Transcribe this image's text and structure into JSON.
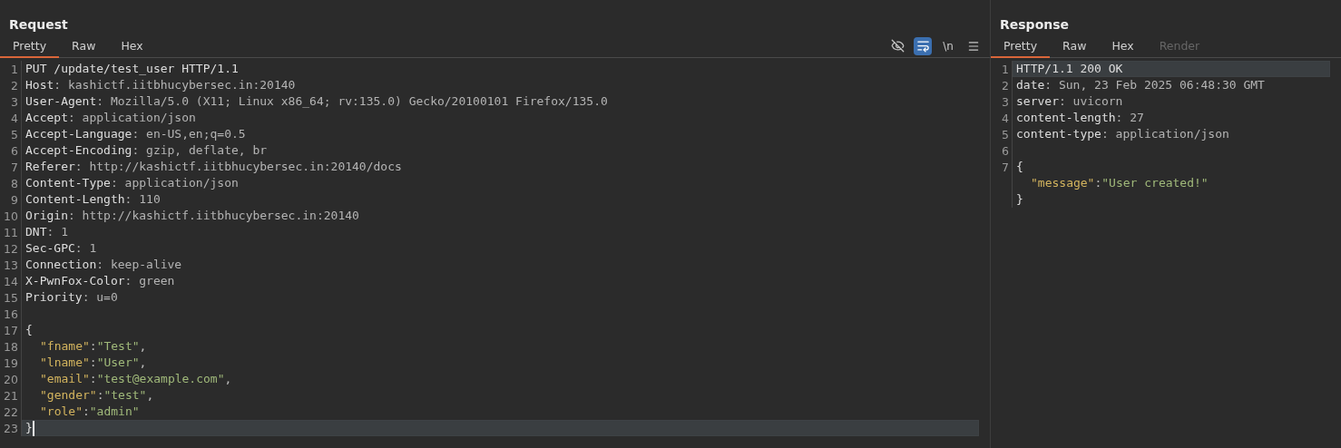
{
  "panes": [
    {
      "title": "Request",
      "tabs": [
        {
          "label": "Pretty",
          "selected": true,
          "disabled": false
        },
        {
          "label": "Raw",
          "selected": false,
          "disabled": false
        },
        {
          "label": "Hex",
          "selected": false,
          "disabled": false
        }
      ],
      "toolbar": [
        {
          "kind": "hide",
          "selected": false
        },
        {
          "kind": "wrap",
          "selected": true
        },
        {
          "kind": "newline",
          "label": "\\n",
          "selected": false
        },
        {
          "kind": "menu",
          "selected": false
        }
      ],
      "lines": [
        {
          "number": "1",
          "current": false,
          "cursor": false,
          "indented": false,
          "segments": [
            {
              "kind": "plain",
              "text": "PUT /update/test_user HTTP/1.1"
            }
          ]
        },
        {
          "number": "2",
          "current": false,
          "cursor": false,
          "indented": false,
          "segments": [
            {
              "kind": "name",
              "text": "Host"
            },
            {
              "kind": "value",
              "text": ": kashictf.iitbhucybersec.in:20140"
            }
          ]
        },
        {
          "number": "3",
          "current": false,
          "cursor": false,
          "indented": false,
          "segments": [
            {
              "kind": "name",
              "text": "User-Agent"
            },
            {
              "kind": "value",
              "text": ": Mozilla/5.0 (X11; Linux x86_64; rv:135.0) Gecko/20100101 Firefox/135.0"
            }
          ]
        },
        {
          "number": "4",
          "current": false,
          "cursor": false,
          "indented": false,
          "segments": [
            {
              "kind": "name",
              "text": "Accept"
            },
            {
              "kind": "value",
              "text": ": application/json"
            }
          ]
        },
        {
          "number": "5",
          "current": false,
          "cursor": false,
          "indented": false,
          "segments": [
            {
              "kind": "name",
              "text": "Accept-Language"
            },
            {
              "kind": "value",
              "text": ": en-US,en;q=0.5"
            }
          ]
        },
        {
          "number": "6",
          "current": false,
          "cursor": false,
          "indented": false,
          "segments": [
            {
              "kind": "name",
              "text": "Accept-Encoding"
            },
            {
              "kind": "value",
              "text": ": gzip, deflate, br"
            }
          ]
        },
        {
          "number": "7",
          "current": false,
          "cursor": false,
          "indented": false,
          "segments": [
            {
              "kind": "name",
              "text": "Referer"
            },
            {
              "kind": "value",
              "text": ": http://kashictf.iitbhucybersec.in:20140/docs"
            }
          ]
        },
        {
          "number": "8",
          "current": false,
          "cursor": false,
          "indented": false,
          "segments": [
            {
              "kind": "name",
              "text": "Content-Type"
            },
            {
              "kind": "value",
              "text": ": application/json"
            }
          ]
        },
        {
          "number": "9",
          "current": false,
          "cursor": false,
          "indented": false,
          "segments": [
            {
              "kind": "name",
              "text": "Content-Length"
            },
            {
              "kind": "value",
              "text": ": 110"
            }
          ]
        },
        {
          "number": "10",
          "current": false,
          "cursor": false,
          "indented": false,
          "segments": [
            {
              "kind": "name",
              "text": "Origin"
            },
            {
              "kind": "value",
              "text": ": http://kashictf.iitbhucybersec.in:20140"
            }
          ]
        },
        {
          "number": "11",
          "current": false,
          "cursor": false,
          "indented": false,
          "segments": [
            {
              "kind": "name",
              "text": "DNT"
            },
            {
              "kind": "value",
              "text": ": 1"
            }
          ]
        },
        {
          "number": "12",
          "current": false,
          "cursor": false,
          "indented": false,
          "segments": [
            {
              "kind": "name",
              "text": "Sec-GPC"
            },
            {
              "kind": "value",
              "text": ": 1"
            }
          ]
        },
        {
          "number": "13",
          "current": false,
          "cursor": false,
          "indented": false,
          "segments": [
            {
              "kind": "name",
              "text": "Connection"
            },
            {
              "kind": "value",
              "text": ": keep-alive"
            }
          ]
        },
        {
          "number": "14",
          "current": false,
          "cursor": false,
          "indented": false,
          "segments": [
            {
              "kind": "name",
              "text": "X-PwnFox-Color"
            },
            {
              "kind": "value",
              "text": ": green"
            }
          ]
        },
        {
          "number": "15",
          "current": false,
          "cursor": false,
          "indented": false,
          "segments": [
            {
              "kind": "name",
              "text": "Priority"
            },
            {
              "kind": "value",
              "text": ": u=0"
            }
          ]
        },
        {
          "number": "16",
          "current": false,
          "cursor": false
        },
        {
          "number": "17",
          "current": false,
          "cursor": false,
          "indented": false,
          "segments": [
            {
              "kind": "plain",
              "text": "{"
            }
          ]
        },
        {
          "number": "18",
          "current": false,
          "cursor": false,
          "indented": true,
          "segments": [
            {
              "kind": "jkey",
              "text": "\"fname\""
            },
            {
              "kind": "punct",
              "text": ":"
            },
            {
              "kind": "jstr",
              "text": "\"Test\""
            },
            {
              "kind": "punct",
              "text": ","
            }
          ]
        },
        {
          "number": "19",
          "current": false,
          "cursor": false,
          "indented": true,
          "segments": [
            {
              "kind": "jkey",
              "text": "\"lname\""
            },
            {
              "kind": "punct",
              "text": ":"
            },
            {
              "kind": "jstr",
              "text": "\"User\""
            },
            {
              "kind": "punct",
              "text": ","
            }
          ]
        },
        {
          "number": "20",
          "current": false,
          "cursor": false,
          "indented": true,
          "segments": [
            {
              "kind": "jkey",
              "text": "\"email\""
            },
            {
              "kind": "punct",
              "text": ":"
            },
            {
              "kind": "jstr",
              "text": "\"test@example.com\""
            },
            {
              "kind": "punct",
              "text": ","
            }
          ]
        },
        {
          "number": "21",
          "current": false,
          "cursor": false,
          "indented": true,
          "segments": [
            {
              "kind": "jkey",
              "text": "\"gender\""
            },
            {
              "kind": "punct",
              "text": ":"
            },
            {
              "kind": "jstr",
              "text": "\"test\""
            },
            {
              "kind": "punct",
              "text": ","
            }
          ]
        },
        {
          "number": "22",
          "current": false,
          "cursor": false,
          "indented": true,
          "segments": [
            {
              "kind": "jkey",
              "text": "\"role\""
            },
            {
              "kind": "punct",
              "text": ":"
            },
            {
              "kind": "jstr",
              "text": "\"admin\""
            }
          ]
        },
        {
          "number": "23",
          "current": true,
          "cursor": true,
          "indented": false,
          "segments": [
            {
              "kind": "plain",
              "text": "}"
            }
          ]
        }
      ]
    },
    {
      "title": "Response",
      "tabs": [
        {
          "label": "Pretty",
          "selected": true,
          "disabled": false
        },
        {
          "label": "Raw",
          "selected": false,
          "disabled": false
        },
        {
          "label": "Hex",
          "selected": false,
          "disabled": false
        },
        {
          "label": "Render",
          "selected": false,
          "disabled": true
        }
      ],
      "lines": [
        {
          "number": "1",
          "current": true,
          "cursor": false,
          "indented": false,
          "segments": [
            {
              "kind": "plain",
              "text": "HTTP/1.1 200 OK"
            }
          ]
        },
        {
          "number": "2",
          "current": false,
          "cursor": false,
          "indented": false,
          "segments": [
            {
              "kind": "name",
              "text": "date"
            },
            {
              "kind": "value",
              "text": ": Sun, 23 Feb 2025 06:48:30 GMT"
            }
          ]
        },
        {
          "number": "3",
          "current": false,
          "cursor": false,
          "indented": false,
          "segments": [
            {
              "kind": "name",
              "text": "server"
            },
            {
              "kind": "value",
              "text": ": uvicorn"
            }
          ]
        },
        {
          "number": "4",
          "current": false,
          "cursor": false,
          "indented": false,
          "segments": [
            {
              "kind": "name",
              "text": "content-length"
            },
            {
              "kind": "value",
              "text": ": 27"
            }
          ]
        },
        {
          "number": "5",
          "current": false,
          "cursor": false,
          "indented": false,
          "segments": [
            {
              "kind": "name",
              "text": "content-type"
            },
            {
              "kind": "value",
              "text": ": application/json"
            }
          ]
        },
        {
          "number": "6",
          "current": false,
          "cursor": false
        },
        {
          "number": "7",
          "current": false,
          "cursor": false,
          "indented": false,
          "segments": [
            {
              "kind": "plain",
              "text": "{"
            }
          ]
        },
        {
          "current": false,
          "cursor": false,
          "indented": true,
          "segments": [
            {
              "kind": "jkey",
              "text": "\"message\""
            },
            {
              "kind": "punct",
              "text": ":"
            },
            {
              "kind": "jstr",
              "text": "\"User created!\""
            }
          ]
        },
        {
          "current": false,
          "cursor": false,
          "indented": false,
          "segments": [
            {
              "kind": "plain",
              "text": "}"
            }
          ]
        }
      ]
    }
  ]
}
